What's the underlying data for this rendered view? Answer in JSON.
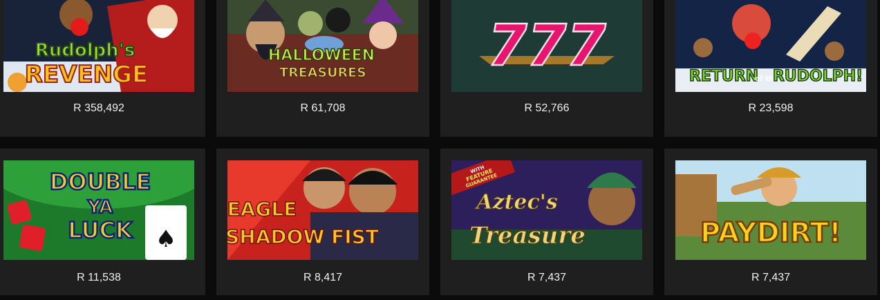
{
  "games": [
    {
      "title_line1": "Rudolph's",
      "title_line2": "REVENGE",
      "jackpot": "R 358,492"
    },
    {
      "title_line1": "HALLOWEEN",
      "title_line2": "TREASURES",
      "jackpot": "R 61,708"
    },
    {
      "title_line1": "777",
      "jackpot": "R 52,766"
    },
    {
      "title_line1": "RETURN",
      "title_mid": "of the",
      "title_line2": "RUDOLPH!",
      "jackpot": "R 23,598"
    },
    {
      "title_line1": "DOUBLE",
      "title_mid": "YA",
      "title_line2": "LUCK",
      "jackpot": "R 11,538"
    },
    {
      "title_line1": "EAGLE",
      "title_line2": "SHADOW FIST",
      "jackpot": "R 8,417"
    },
    {
      "badge_line1": "WITH",
      "badge_line2": "FEATURE",
      "badge_line3": "GUARANTEE",
      "title_line1": "Aztec's",
      "title_line2": "Treasure",
      "jackpot": "R 7,437"
    },
    {
      "title_line1": "PAYDIRT!",
      "jackpot": "R 7,437"
    }
  ],
  "colors": {
    "page_bg": "#0b0b0b",
    "card_bg": "#1f1f1f",
    "amount_text": "#f0f0f0"
  }
}
